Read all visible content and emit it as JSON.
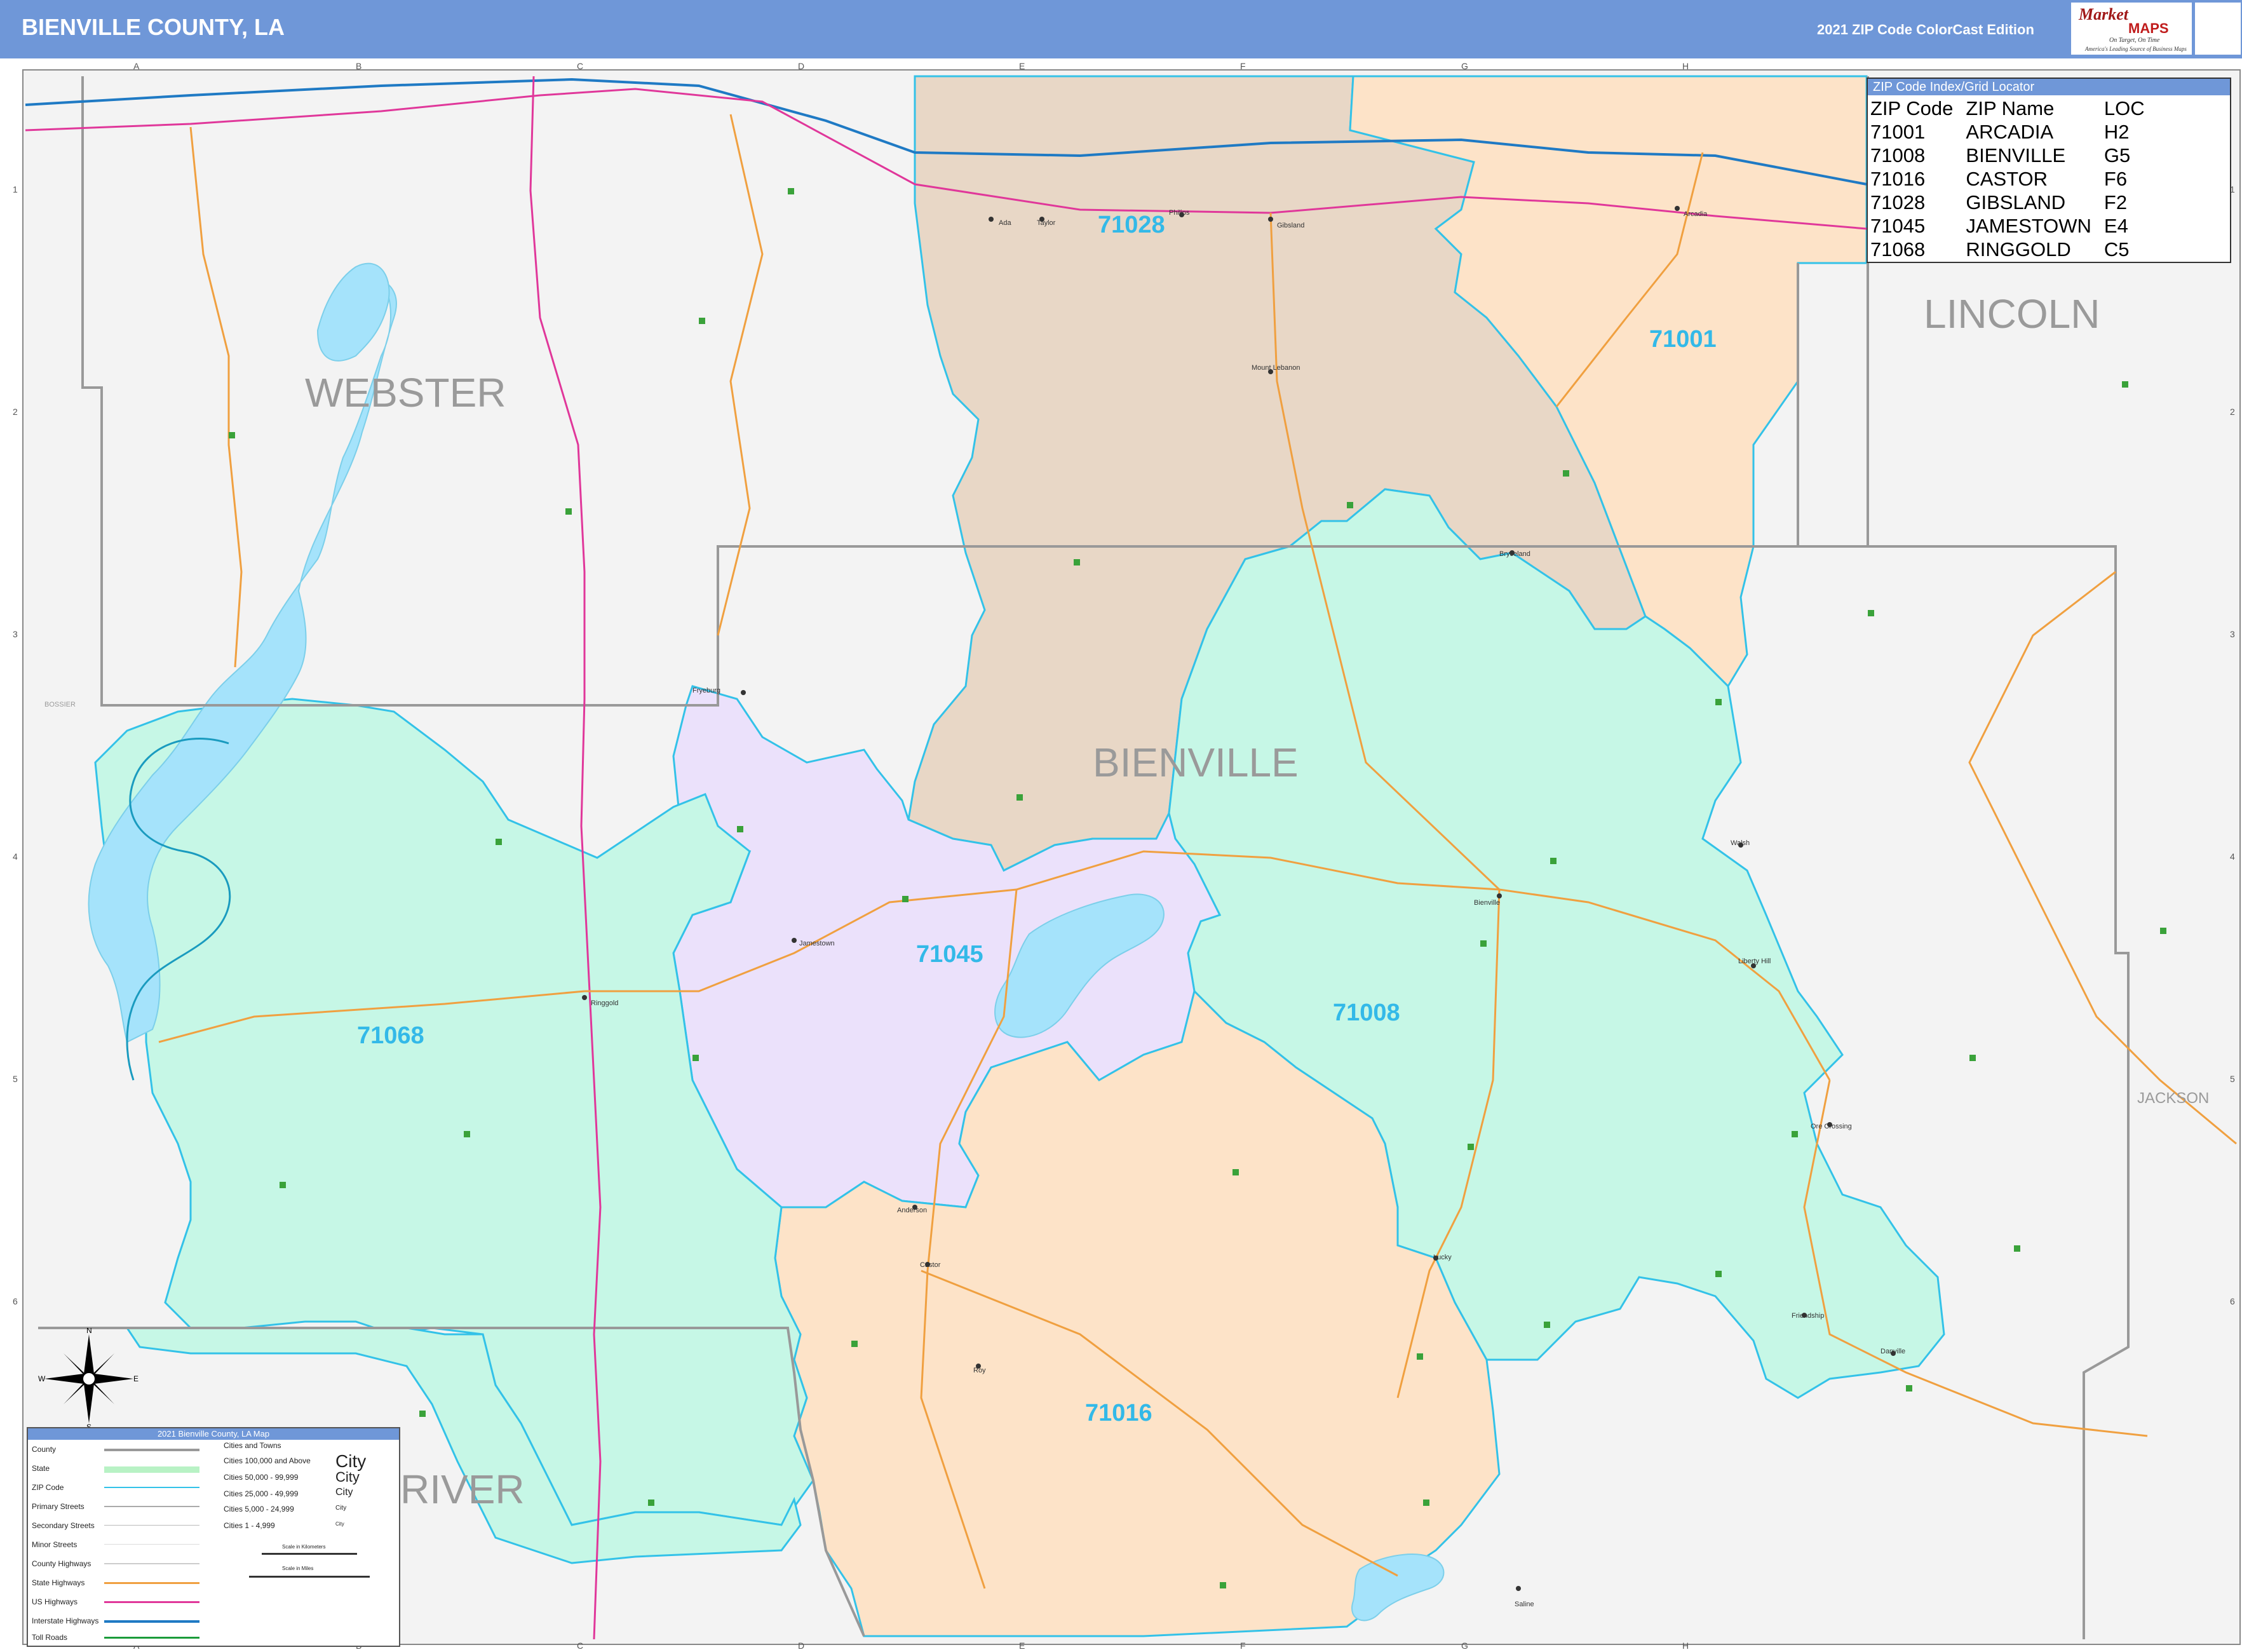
{
  "header": {
    "title": "BIENVILLE COUNTY, LA",
    "edition": "2021 ZIP Code ColorCast Edition",
    "logo_brand_1": "Market",
    "logo_brand_2": "MAPS",
    "logo_tagline_1": "On Target, On Time",
    "logo_tagline_2": "America's Leading Source of Business Maps"
  },
  "grid": {
    "letters": [
      "A",
      "B",
      "C",
      "D",
      "E",
      "F",
      "G",
      "H"
    ],
    "numbers": [
      "1",
      "2",
      "3",
      "4",
      "5",
      "6"
    ]
  },
  "county_labels": {
    "webster": "WEBSTER",
    "lincoln": "LINCOLN",
    "bienville": "BIENVILLE",
    "jackson": "JACKSON",
    "river": "RIVER",
    "bossier": "BOSSIER"
  },
  "zip_labels": {
    "z71001": "71001",
    "z71008": "71008",
    "z71016": "71016",
    "z71028": "71028",
    "z71045": "71045",
    "z71068": "71068"
  },
  "towns": {
    "arcadia": "Arcadia",
    "gibsland": "Gibsland",
    "ringgold": "Ringgold",
    "bienville": "Bienville",
    "castor": "Castor",
    "jamestown": "Jamestown",
    "saline": "Saline",
    "friendship": "Friendship",
    "danville": "Danville",
    "mount_lebanon": "Mount Lebanon",
    "bryceland": "Bryceland",
    "liberty_hill": "Liberty Hill",
    "lucky": "Lucky",
    "roy": "Roy",
    "taylor": "Taylor",
    "philips": "Philips",
    "ada": "Ada",
    "fryeburg": "Fryeburg",
    "walsh": "Walsh",
    "ore_crossing": "Ore Crossing",
    "anderson": "Anderson"
  },
  "zip_index": {
    "title": "ZIP Code Index/Grid Locator",
    "columns": [
      "ZIP Code",
      "ZIP Name",
      "LOC"
    ],
    "rows": [
      [
        "71001",
        "ARCADIA",
        "H2"
      ],
      [
        "71008",
        "BIENVILLE",
        "G5"
      ],
      [
        "71016",
        "CASTOR",
        "F6"
      ],
      [
        "71028",
        "GIBSLAND",
        "F2"
      ],
      [
        "71045",
        "JAMESTOWN",
        "E4"
      ],
      [
        "71068",
        "RINGGOLD",
        "C5"
      ]
    ]
  },
  "legend": {
    "title": "2021 Bienville County, LA Map",
    "items": [
      "County",
      "State",
      "ZIP Code",
      "Primary Streets",
      "Secondary Streets",
      "Minor Streets",
      "County Highways",
      "State Highways",
      "US Highways",
      "Interstate Highways",
      "Toll Roads"
    ],
    "cities_title": "Cities and Towns",
    "city_classes": [
      "Cities 100,000 and Above",
      "Cities 50,000 - 99,999",
      "Cities 25,000 - 49,999",
      "Cities 5,000 - 24,999",
      "Cities 1 - 4,999"
    ],
    "city_samples": [
      "City",
      "City",
      "City",
      "City",
      "City"
    ],
    "scale_km": "Scale in Kilometers",
    "scale_mi": "Scale in Miles"
  },
  "compass": {
    "n": "N",
    "s": "S",
    "e": "E",
    "w": "W"
  },
  "colors": {
    "zip_71028": "#e8d7c6",
    "zip_71001": "#fde3c8",
    "zip_71008": "#c6f7e6",
    "zip_71068": "#c6f7e6",
    "zip_71045": "#ebe1fb",
    "zip_71016": "#fde3c8",
    "outside": "#f3f3f3",
    "water": "#a5e3fb",
    "zip_boundary": "#33c2e8",
    "interstate": "#1f7ac4",
    "us_highway": "#e0379a",
    "state_highway": "#f0a040",
    "county_line": "#999999"
  }
}
